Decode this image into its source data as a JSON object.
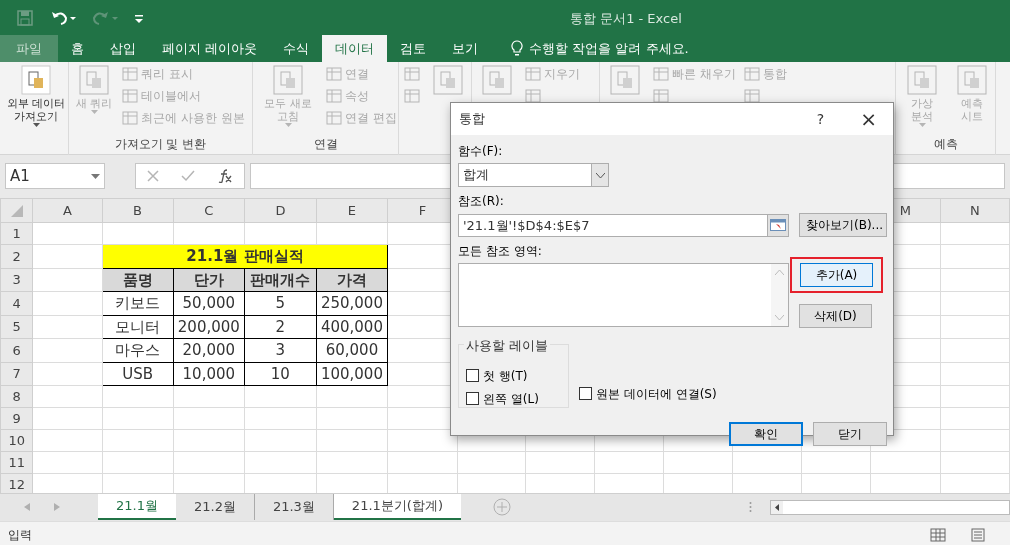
{
  "title_bar": {
    "title": "통합 문서1 - Excel"
  },
  "ribbon_tabs": [
    {
      "label": "파일",
      "kind": "file",
      "selected": false
    },
    {
      "label": "홈",
      "kind": "tab",
      "selected": false
    },
    {
      "label": "삽입",
      "kind": "tab",
      "selected": false
    },
    {
      "label": "페이지 레이아웃",
      "kind": "tab",
      "selected": false
    },
    {
      "label": "수식",
      "kind": "tab",
      "selected": false
    },
    {
      "label": "데이터",
      "kind": "tab",
      "selected": true
    },
    {
      "label": "검토",
      "kind": "tab",
      "selected": false
    },
    {
      "label": "보기",
      "kind": "tab",
      "selected": false
    }
  ],
  "tell_me": {
    "text": "수행할 작업을 알려 주세요."
  },
  "ribbon": {
    "groups": [
      {
        "buttons": [
          {
            "kind": "large",
            "label": "외부 데이터 가져오기",
            "menu": true,
            "disabled": false
          }
        ]
      },
      {
        "label": "가져오기 및 변환",
        "buttons": [
          {
            "kind": "large",
            "label": "새 쿼리",
            "menu": true,
            "disabled": true
          },
          {
            "kind": "stack",
            "buttons": [
              {
                "label": "쿼리 표시",
                "disabled": true
              },
              {
                "label": "테이블에서",
                "disabled": true
              },
              {
                "label": "최근에 사용한 원본",
                "disabled": true
              }
            ]
          }
        ]
      },
      {
        "label": "연결",
        "buttons": [
          {
            "kind": "large",
            "label": "모두 새로 고침",
            "menu": true,
            "disabled": true
          },
          {
            "kind": "stack",
            "buttons": [
              {
                "label": "연결",
                "disabled": true
              },
              {
                "label": "속성",
                "disabled": true
              },
              {
                "label": "연결 편집",
                "disabled": true
              }
            ]
          }
        ]
      },
      {
        "buttons": [
          {
            "kind": "stack",
            "buttons": [
              {
                "disabled": true
              },
              {
                "disabled": true
              }
            ]
          },
          {
            "kind": "large",
            "disabled": true
          }
        ]
      },
      {
        "buttons": [
          {
            "kind": "large",
            "disabled": true
          },
          {
            "kind": "stack",
            "buttons": [
              {
                "label": "지우기",
                "disabled": true
              },
              {
                "disabled": true
              }
            ]
          }
        ]
      },
      {
        "buttons": [
          {
            "kind": "large",
            "disabled": true
          },
          {
            "kind": "stack",
            "buttons": [
              {
                "label": "빠른 채우기",
                "disabled": true
              },
              {
                "disabled": true
              }
            ]
          },
          {
            "kind": "stack",
            "buttons": [
              {
                "label": "통합",
                "disabled": true
              },
              {
                "disabled": true
              }
            ]
          }
        ]
      },
      {
        "label": "예측",
        "buttons": [
          {
            "kind": "large",
            "label": "가상 분석",
            "menu": true,
            "disabled": true
          },
          {
            "kind": "large",
            "label": "예측 시트",
            "disabled": true
          }
        ]
      }
    ]
  },
  "name_box": {
    "value": "A1"
  },
  "sheet": {
    "columns": [
      "A",
      "B",
      "C",
      "D",
      "E",
      "F",
      "M",
      "N"
    ],
    "rows": [
      "1",
      "2",
      "3",
      "4",
      "5",
      "6",
      "7",
      "8",
      "9",
      "10",
      "11",
      "12"
    ],
    "table": {
      "title": "21.1월 판매실적",
      "header": [
        "품명",
        "단가",
        "판매개수",
        "가격"
      ],
      "rows": [
        [
          "키보드",
          "50,000",
          "5",
          "250,000"
        ],
        [
          "모니터",
          "200,000",
          "2",
          "400,000"
        ],
        [
          "마우스",
          "20,000",
          "3",
          "60,000"
        ],
        [
          "USB",
          "10,000",
          "10",
          "100,000"
        ]
      ]
    }
  },
  "sheet_tabs": [
    {
      "label": "21.1월",
      "selected": true,
      "active": true
    },
    {
      "label": "21.2월",
      "selected": false,
      "active": false
    },
    {
      "label": "21.3월",
      "selected": false,
      "active": false
    },
    {
      "label": "21.1분기(합계)",
      "selected": true,
      "active": false
    }
  ],
  "status_bar": {
    "mode": "입력"
  },
  "dialog": {
    "title": "통합",
    "help": "?",
    "close": "×",
    "function_label": "함수(F):",
    "function_value": "합계",
    "reference_label": "참조(R):",
    "reference_value": "'21.1월'!$D$4:$E$7",
    "browse_button": "찾아보기(B)...",
    "all_references_label": "모든 참조 영역:",
    "side_buttons": [
      {
        "label": "추가(A)",
        "highlighted": true,
        "hovered": true
      },
      {
        "label": "삭제(D)",
        "highlighted": false,
        "hovered": false
      }
    ],
    "labels_group": "사용할 레이블",
    "checkboxes": [
      {
        "label": "첫 행(T)",
        "checked": false
      },
      {
        "label": "왼쪽 열(L)",
        "checked": false
      },
      {
        "label": "원본 데이터에 연결(S)",
        "checked": false
      }
    ],
    "footer_buttons": [
      {
        "label": "확인",
        "default": true
      },
      {
        "label": "닫기",
        "default": false
      }
    ]
  }
}
